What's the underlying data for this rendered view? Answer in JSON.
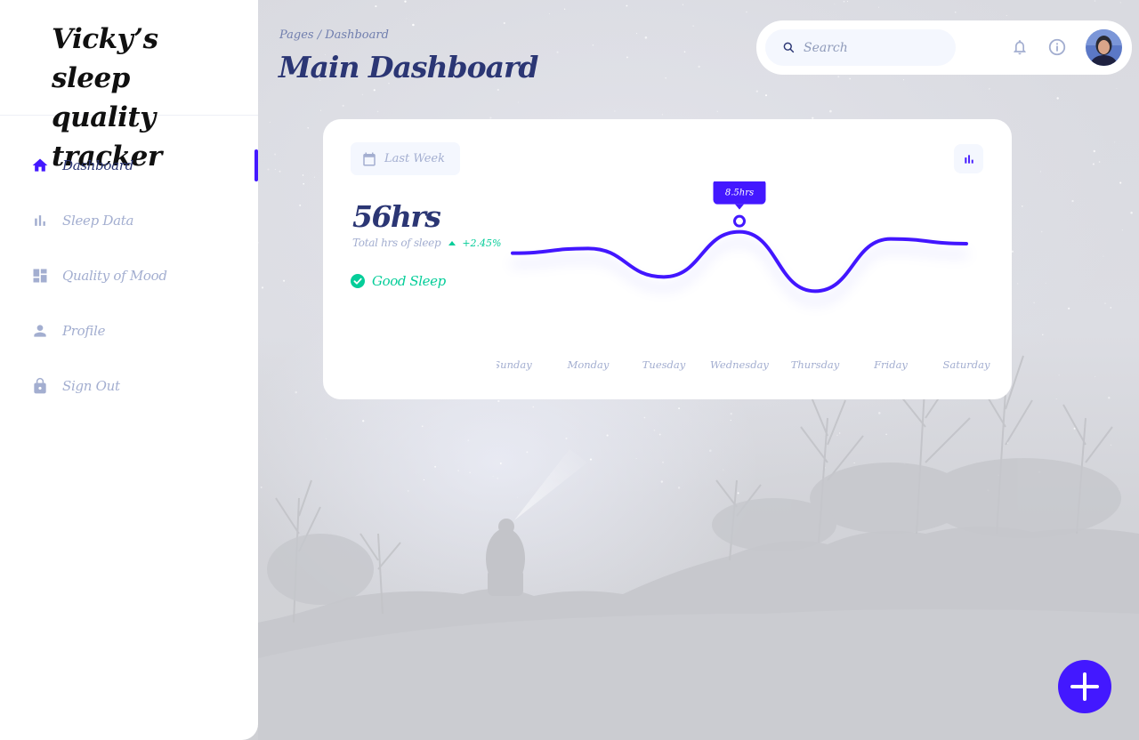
{
  "sidebar": {
    "brand": "Vicky’s sleep quality tracker",
    "items": [
      {
        "label": "Dashboard",
        "icon": "home-icon",
        "active": true
      },
      {
        "label": "Sleep Data",
        "icon": "bar-chart-icon",
        "active": false
      },
      {
        "label": "Quality of Mood",
        "icon": "dashboard-grid-icon",
        "active": false
      },
      {
        "label": "Profile",
        "icon": "person-icon",
        "active": false
      },
      {
        "label": "Sign Out",
        "icon": "lock-icon",
        "active": false
      }
    ]
  },
  "header": {
    "breadcrumb": "Pages / Dashboard",
    "title": "Main Dashboard"
  },
  "topbar": {
    "search_placeholder": "Search",
    "search_value": "",
    "icons": [
      "search-icon",
      "bell-icon",
      "info-icon",
      "avatar"
    ]
  },
  "card": {
    "range_label": "Last Week",
    "total_value": "56hrs",
    "total_label": "Total hrs of sleep",
    "trend_value": "+2.45%",
    "status_label": "Good Sleep",
    "tooltip_label": "8.5hrs"
  },
  "chart_data": {
    "type": "line",
    "categories": [
      "Sunday",
      "Monday",
      "Tuesday",
      "Wednesday",
      "Thursday",
      "Friday",
      "Saturday"
    ],
    "series": [
      {
        "values": [
          7.6,
          7.8,
          6.6,
          8.5,
          6.0,
          8.2,
          8.0
        ]
      }
    ],
    "highlight_index": 3,
    "ylim": [
      5,
      9.5
    ],
    "grid": false,
    "title": "",
    "xlabel": "",
    "ylabel": ""
  },
  "colors": {
    "accent": "#4318ff",
    "navy": "#2b3674",
    "muted": "#a3aed0",
    "success": "#05cd99"
  }
}
